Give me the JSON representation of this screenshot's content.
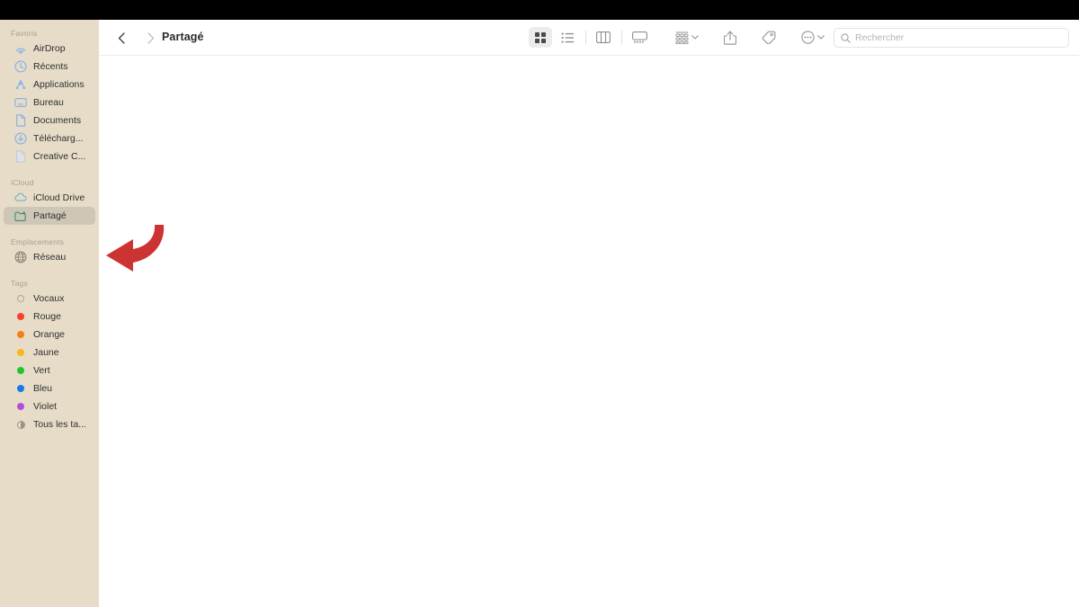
{
  "window": {
    "title": "Partagé",
    "nav": {
      "back_label": "Précédent",
      "forward_label": "Suivant"
    }
  },
  "toolbar": {
    "views": [
      {
        "name": "icon-view",
        "label": "Vue par icônes",
        "active": true
      },
      {
        "name": "list-view",
        "label": "Vue par liste",
        "active": false
      },
      {
        "name": "column-view",
        "label": "Vue par colonnes",
        "active": false
      },
      {
        "name": "gallery-view",
        "label": "Vue par galerie",
        "active": false
      }
    ],
    "actions": [
      {
        "name": "group-by",
        "label": "Grouper"
      },
      {
        "name": "share",
        "label": "Partager"
      },
      {
        "name": "tags",
        "label": "Tags"
      },
      {
        "name": "more",
        "label": "Plus"
      }
    ]
  },
  "search": {
    "placeholder": "Rechercher",
    "value": ""
  },
  "sidebar": {
    "sections": [
      {
        "header": "Favoris",
        "items": [
          {
            "label": "AirDrop",
            "icon": "airdrop-icon",
            "selected": false
          },
          {
            "label": "Récents",
            "icon": "clock-icon",
            "selected": false
          },
          {
            "label": "Applications",
            "icon": "applications-icon",
            "selected": false
          },
          {
            "label": "Bureau",
            "icon": "desktop-icon",
            "selected": false
          },
          {
            "label": "Documents",
            "icon": "document-icon",
            "selected": false
          },
          {
            "label": "Télécharg...",
            "icon": "downloads-icon",
            "selected": false
          },
          {
            "label": "Creative C...",
            "icon": "document-grey-icon",
            "selected": false
          }
        ]
      },
      {
        "header": "iCloud",
        "items": [
          {
            "label": "iCloud Drive",
            "icon": "cloud-icon",
            "selected": false
          },
          {
            "label": "Partagé",
            "icon": "shared-folder-icon",
            "selected": true
          }
        ]
      },
      {
        "header": "Emplacements",
        "items": [
          {
            "label": "Réseau",
            "icon": "network-globe-icon",
            "selected": false
          }
        ]
      },
      {
        "header": "Tags",
        "items": [
          {
            "label": "Vocaux",
            "icon": "tag-dot-hollow",
            "color": "",
            "selected": false
          },
          {
            "label": "Rouge",
            "icon": "tag-dot",
            "color": "#f5402c",
            "selected": false
          },
          {
            "label": "Orange",
            "icon": "tag-dot",
            "color": "#f77d15",
            "selected": false
          },
          {
            "label": "Jaune",
            "icon": "tag-dot",
            "color": "#f7b916",
            "selected": false
          },
          {
            "label": "Vert",
            "icon": "tag-dot",
            "color": "#20c631",
            "selected": false
          },
          {
            "label": "Bleu",
            "icon": "tag-dot",
            "color": "#1878f0",
            "selected": false
          },
          {
            "label": "Violet",
            "icon": "tag-dot",
            "color": "#b24ed8",
            "selected": false
          },
          {
            "label": "Tous les ta...",
            "icon": "tag-dot-half",
            "color": "",
            "selected": false
          }
        ]
      }
    ]
  },
  "annotation": {
    "arrow_color": "#cc3333",
    "points_at": "Partagé"
  },
  "colors": {
    "sidebar_bg": "#e6dcc7",
    "selection_bg": "#cfc7b6",
    "menubar_bg": "#000000",
    "accent_blue": "#8ab4e8"
  }
}
